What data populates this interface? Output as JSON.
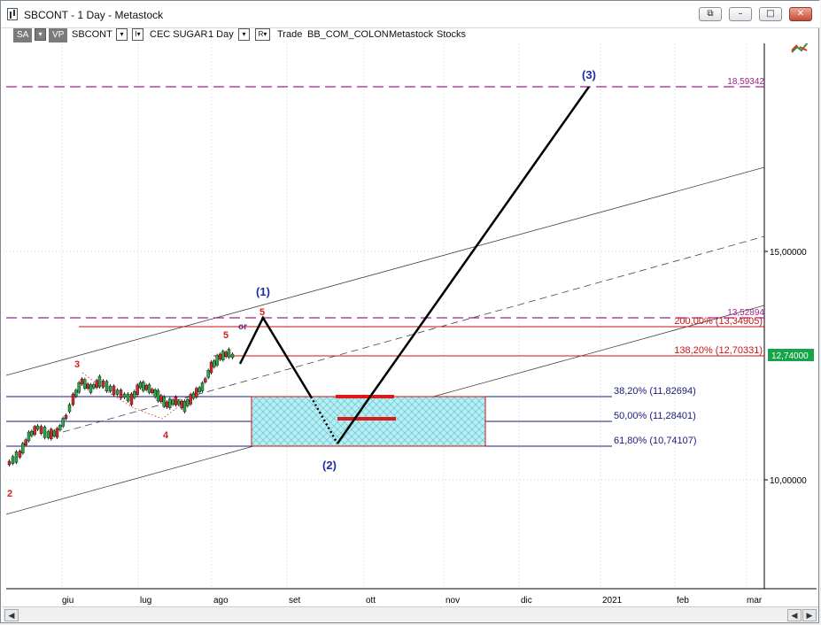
{
  "window": {
    "title": "SBCONT - 1 Day - Metastock",
    "buttons": {
      "restore_alt": "⧉",
      "minimize": "–",
      "maximize": "□",
      "close": "✕"
    }
  },
  "toolbar": {
    "sa_label": "SA",
    "vp_label": "VP",
    "symbol": "SBCONT",
    "dropdown_glyph": "▾",
    "i_label": "I▾",
    "security_name": "CEC SUGAR",
    "period": "1 Day",
    "r_label": "R▾",
    "trade_label": "Trade",
    "source": "BB_COM_COLON",
    "app": "Metastock",
    "category": "Stocks"
  },
  "axes": {
    "x_ticks": [
      "giu",
      "lug",
      "ago",
      "set",
      "ott",
      "nov",
      "dic",
      "2021",
      "feb",
      "mar"
    ],
    "y_ticks": [
      "15,00000",
      "10,00000"
    ],
    "last_price": "12,74000",
    "price_color": "#17a34a"
  },
  "levels": {
    "top_target": "18,59342",
    "upper_dashed": "13,52894",
    "fib_200": "200,00% (13,34905)",
    "fib_138": "138,20% (12,70331)",
    "ret_38": "38,20% (11,82694)",
    "ret_50": "50,00% (11,28401)",
    "ret_61": "61,80% (10,74107)"
  },
  "wave_labels": {
    "w1": "(1)",
    "w2": "(2)",
    "w3": "(3)",
    "sub5a": "5",
    "sub5b": "5",
    "sub_or": "or",
    "sub3": "3",
    "sub4": "4",
    "sub2": "2"
  },
  "colors": {
    "wave_blue": "#1d2fa3",
    "sub_red": "#cc2222",
    "fib_red": "#cc1111",
    "retr_navy": "#1a1a7a",
    "target_purple": "#a0228f",
    "zone_fill": "#b5f0f5",
    "zone_border": "#d01010"
  },
  "chart_data": {
    "type": "candlestick",
    "x": [
      "giu",
      "lug",
      "ago",
      "set",
      "ott",
      "nov",
      "dic",
      "2021",
      "feb",
      "mar"
    ],
    "ylabel": "",
    "yticks": [
      10.0,
      15.0
    ],
    "horizontal_levels": [
      18.59342,
      13.52894,
      13.34905,
      12.70331,
      11.82694,
      11.28401,
      10.74107
    ],
    "last_close": 12.74
  }
}
